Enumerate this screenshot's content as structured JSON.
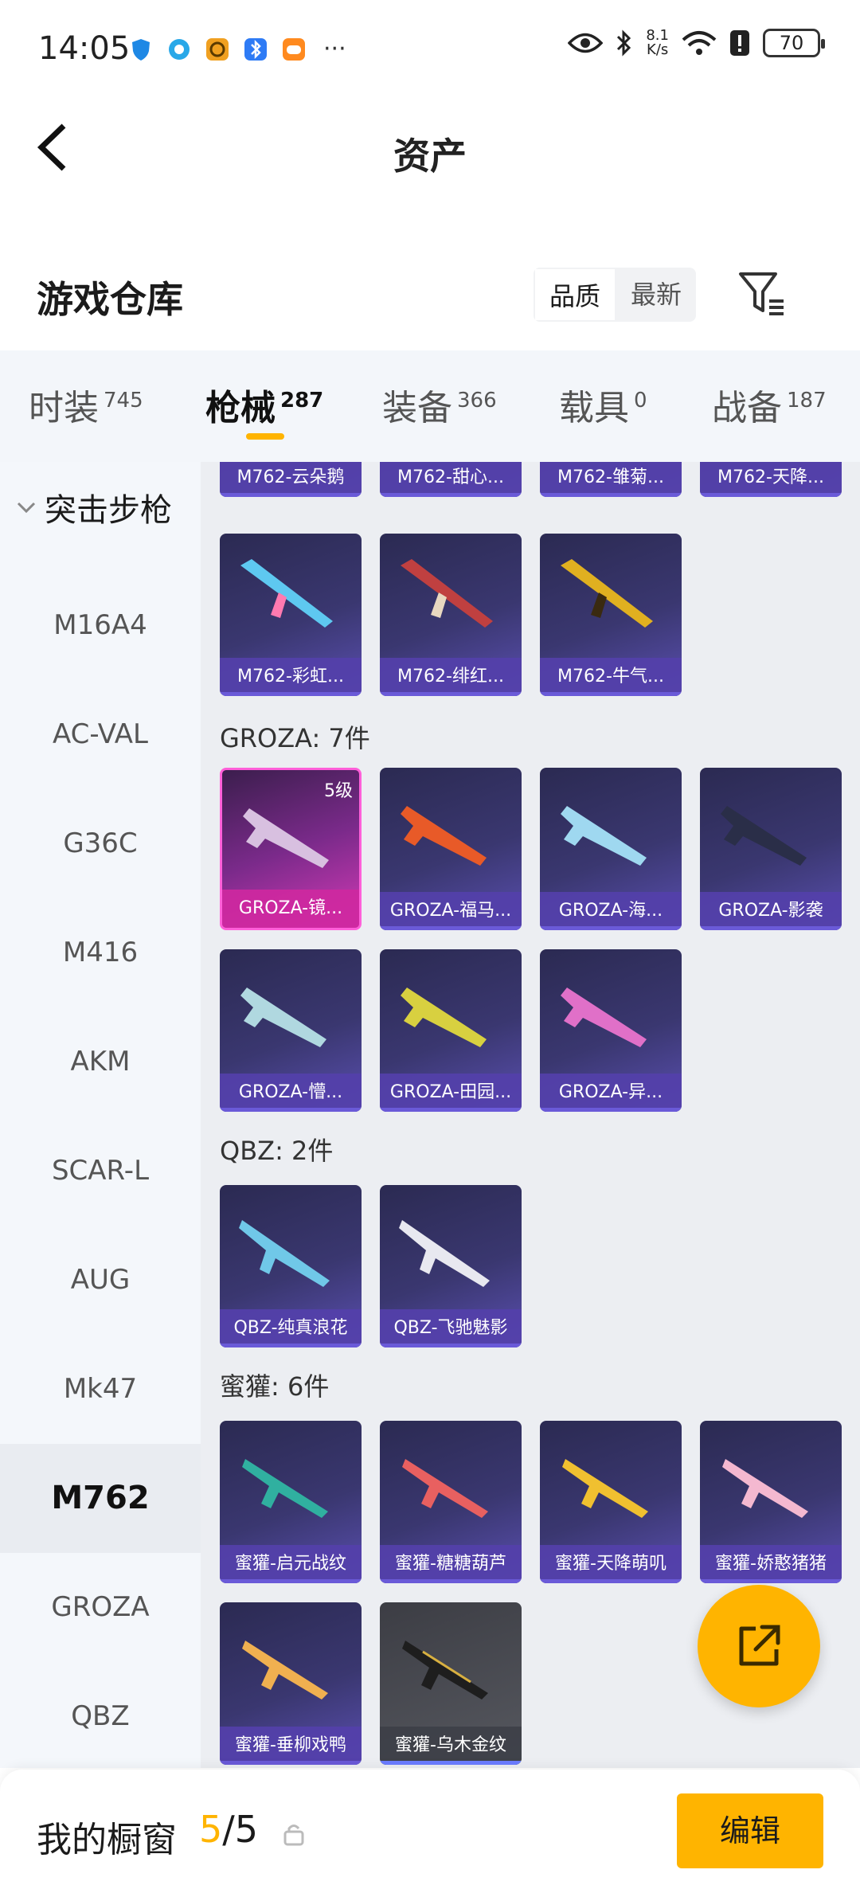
{
  "status_bar": {
    "time": "14:05",
    "more": "···",
    "speed_value": "8.1",
    "speed_unit": "K/s",
    "battery": "70",
    "icons": [
      "shield-app-icon",
      "browser-app-icon",
      "camera-app-icon",
      "bluetooth-app-icon",
      "game-app-icon",
      "eye-icon",
      "bluetooth-icon",
      "wifi-icon",
      "alert-icon",
      "battery-icon"
    ]
  },
  "header": {
    "title": "资产"
  },
  "section": {
    "title": "游戏仓库",
    "sort_options": [
      "品质",
      "最新"
    ],
    "sort_active": "品质"
  },
  "tabs": [
    {
      "label": "时装",
      "count": "745"
    },
    {
      "label": "枪械",
      "count": "287",
      "active": true
    },
    {
      "label": "装备",
      "count": "366"
    },
    {
      "label": "载具",
      "count": "0"
    },
    {
      "label": "战备",
      "count": "187"
    }
  ],
  "sidebar": {
    "group": "突击步枪",
    "items": [
      "M16A4",
      "AC-VAL",
      "G36C",
      "M416",
      "AKM",
      "SCAR-L",
      "AUG",
      "Mk47",
      "M762",
      "GROZA",
      "QBZ"
    ],
    "active": "M762"
  },
  "groups": {
    "m762_row1": [
      "M762-云朵鹅",
      "M762-甜心...",
      "M762-雏菊...",
      "M762-天降..."
    ],
    "m762_row2": [
      "M762-彩虹...",
      "M762-绯红...",
      "M762-牛气..."
    ],
    "groza_title": "GROZA: 7件",
    "groza": [
      "GROZA-镜...",
      "GROZA-福马...",
      "GROZA-海...",
      "GROZA-影袭",
      "GROZA-懵...",
      "GROZA-田园...",
      "GROZA-异..."
    ],
    "groza_badge": "5级",
    "qbz_title": "QBZ: 2件",
    "qbz": [
      "QBZ-纯真浪花",
      "QBZ-飞驰魅影"
    ],
    "mihuo_title": "蜜獾: 6件",
    "mihuo": [
      "蜜獾-启元战纹",
      "蜜獾-糖糖葫芦",
      "蜜獾-天降萌叽",
      "蜜獾-娇憨猪猪",
      "蜜獾-垂柳戏鸭",
      "蜜獾-乌木金纹"
    ]
  },
  "bottom": {
    "showcase_label": "我的橱窗",
    "current": "5",
    "sep_total": "/5",
    "edit_label": "编辑"
  },
  "colors": {
    "accent": "#ffb400",
    "card_purple": "#5440aa",
    "card_pink": "#ce28a0"
  }
}
